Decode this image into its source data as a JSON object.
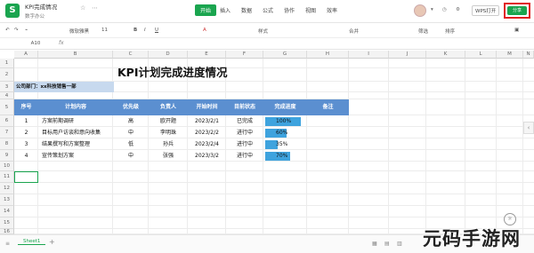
{
  "titlebar": {
    "app_icon": "S",
    "doc_title": "KPI完成情况",
    "doc_subtitle": "数字办公",
    "menus": [
      "开始",
      "插入",
      "数据",
      "公式",
      "协作",
      "视图",
      "效率"
    ],
    "active_menu": "开始",
    "wps_open": "WPS打开",
    "share": "分享"
  },
  "toolbar": {
    "font": "微软雅黑",
    "size": "11",
    "items": [
      "B",
      "I",
      "U",
      "A",
      "样式",
      "合并",
      "筛选",
      "排序"
    ]
  },
  "formula_bar": {
    "cell_ref": "A10",
    "fx": "fx",
    "value": ""
  },
  "columns": [
    "A",
    "B",
    "C",
    "D",
    "E",
    "F",
    "G",
    "H",
    "I",
    "J",
    "K",
    "L",
    "M",
    "N"
  ],
  "rows": [
    "1",
    "2",
    "3",
    "4",
    "5",
    "6",
    "7",
    "8",
    "9",
    "10",
    "11",
    "12",
    "13",
    "14",
    "15",
    "16",
    "17",
    "18"
  ],
  "sheet": {
    "title": "KPI计划完成进度情况",
    "department": "公司部门：xx科技销售一部",
    "headers": [
      "序号",
      "计划内容",
      "优先级",
      "负责人",
      "开始时间",
      "目前状态",
      "完成进度",
      "备注"
    ],
    "tasks": [
      {
        "id": "1",
        "content": "方案前期调研",
        "priority": "高",
        "owner": "欧开题",
        "start": "2023/2/1",
        "status": "已完成",
        "progress": "100%",
        "progress_value": 1.0
      },
      {
        "id": "2",
        "content": "目标用户访谈和意向收集",
        "priority": "中",
        "owner": "李明珠",
        "start": "2023/2/2",
        "status": "进行中",
        "progress": "60%",
        "progress_value": 0.6
      },
      {
        "id": "3",
        "content": "结果撰写和方案整理",
        "priority": "低",
        "owner": "孙兵",
        "start": "2023/2/4",
        "status": "进行中",
        "progress": "35%",
        "progress_value": 0.35
      },
      {
        "id": "4",
        "content": "宣传策划方案",
        "priority": "中",
        "owner": "张强",
        "start": "2023/3/2",
        "status": "进行中",
        "progress": "70%",
        "progress_value": 0.7
      }
    ]
  },
  "bottom": {
    "sheet_tab": "Sheet1",
    "add": "+"
  },
  "watermark": "元码手游网",
  "colors": {
    "accent": "#1aa54f",
    "header_blue": "#5b8fd0",
    "bar_blue": "#3ea3de",
    "dept_fill": "#c7d9ee",
    "highlight_red": "#e02020"
  }
}
